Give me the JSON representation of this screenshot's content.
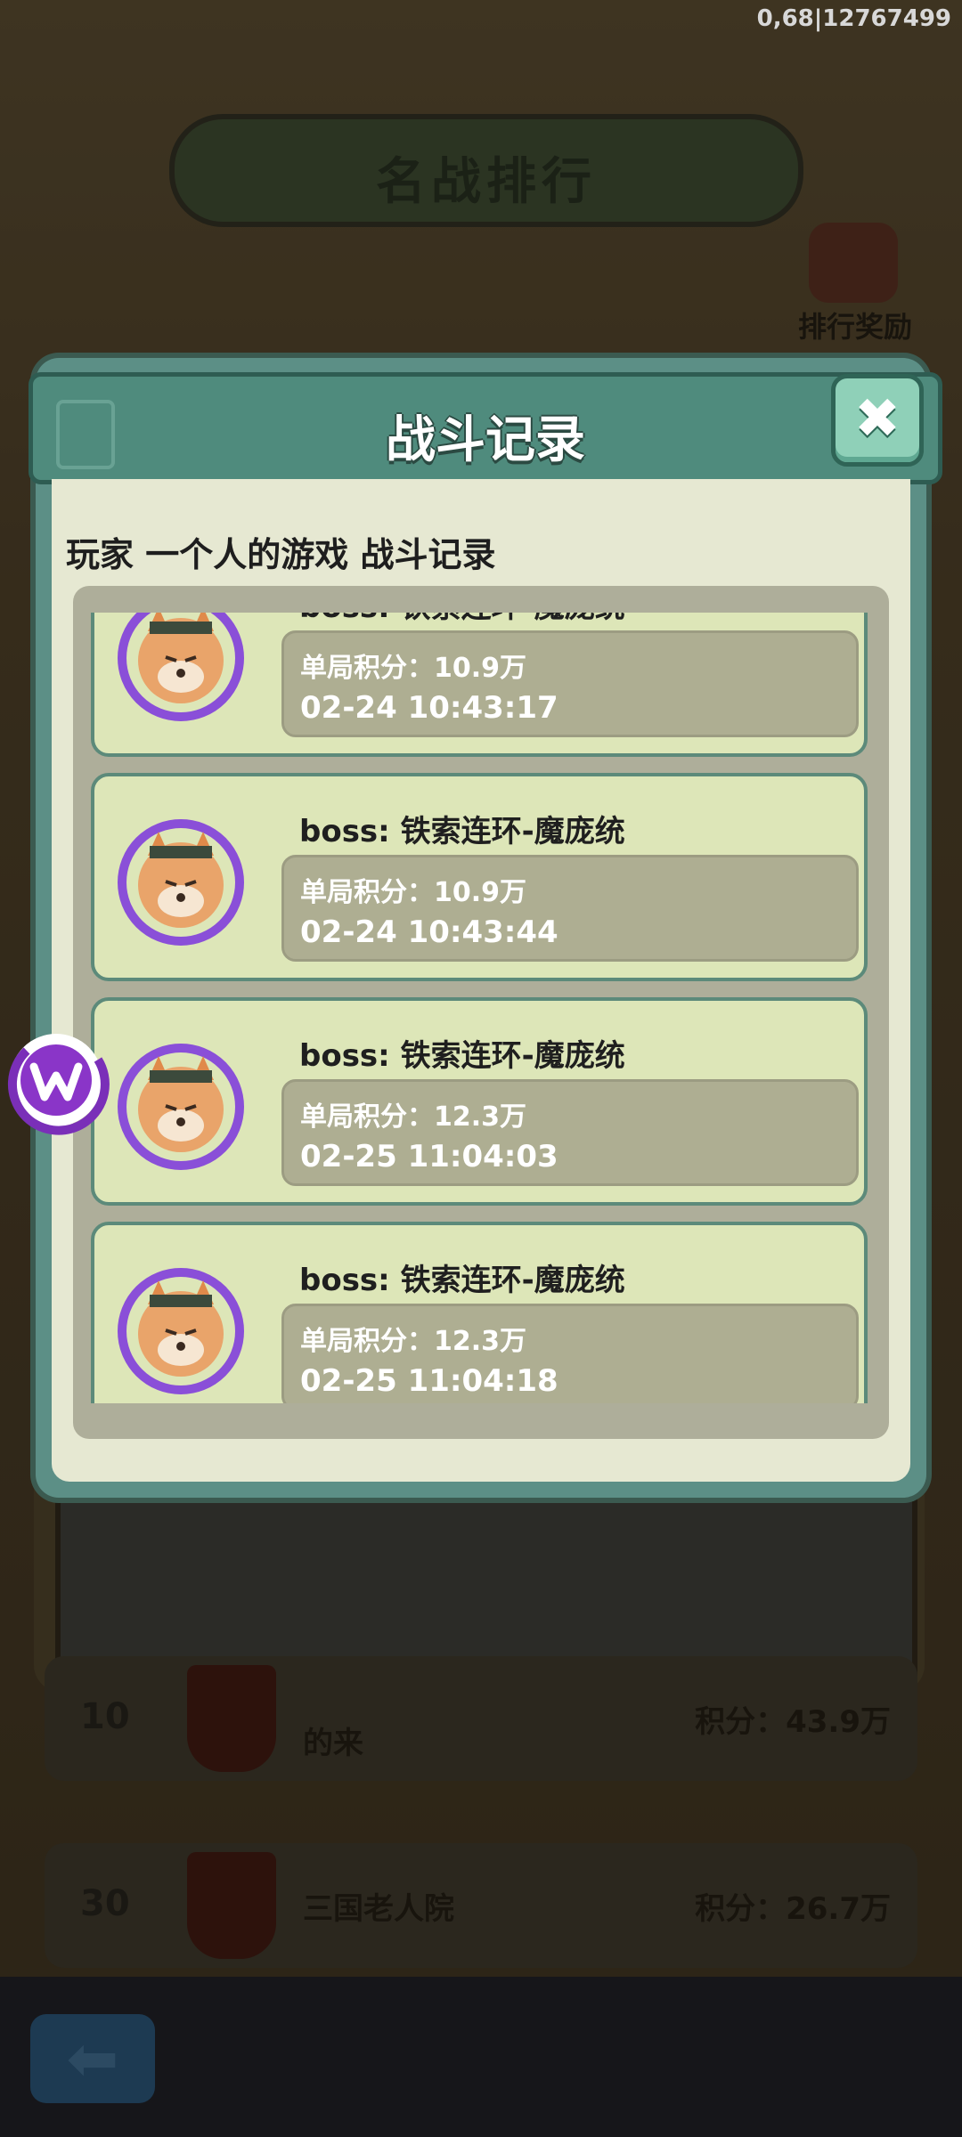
{
  "status_bar": {
    "text": "0,68|12767499"
  },
  "background": {
    "title": "名战排行",
    "reward_label": "排行奖励",
    "rows": [
      {
        "rank": "10",
        "name": "的来",
        "score": "积分：43.9万"
      },
      {
        "rank": "30",
        "name": "三国老人院",
        "score": "积分：26.7万"
      }
    ],
    "back_icon": "back-arrow-icon"
  },
  "modal": {
    "title": "战斗记录",
    "close_icon": "close-icon",
    "subtitle": "玩家 一个人的游戏 战斗记录",
    "records": [
      {
        "boss": "boss: 铁索连环-魔庞统",
        "score": "单局积分：10.9万",
        "time": "02-24 10:43:17"
      },
      {
        "boss": "boss: 铁索连环-魔庞统",
        "score": "单局积分：10.9万",
        "time": "02-24 10:43:44"
      },
      {
        "boss": "boss: 铁索连环-魔庞统",
        "score": "单局积分：12.3万",
        "time": "02-25 11:04:03"
      },
      {
        "boss": "boss: 铁索连环-魔庞统",
        "score": "单局积分：12.3万",
        "time": "02-25 11:04:18"
      }
    ]
  },
  "colors": {
    "accent_teal": "#4f8b7d",
    "card_bg": "#dde6b8",
    "boss_purple": "#8a4fd8"
  }
}
